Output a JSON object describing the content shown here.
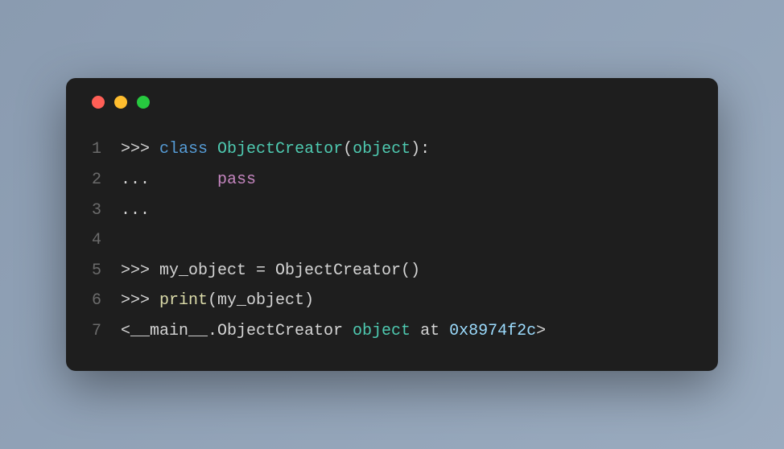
{
  "window": {
    "traffic_lights": [
      "red",
      "yellow",
      "green"
    ]
  },
  "code": {
    "lines": [
      {
        "n": "1",
        "tokens": [
          {
            "t": ">>> ",
            "c": "tk-prompt"
          },
          {
            "t": "class",
            "c": "tk-keyword"
          },
          {
            "t": " ",
            "c": "tk-default"
          },
          {
            "t": "ObjectCreator",
            "c": "tk-classname"
          },
          {
            "t": "(",
            "c": "tk-punct"
          },
          {
            "t": "object",
            "c": "tk-builtin"
          },
          {
            "t": "):",
            "c": "tk-punct"
          }
        ]
      },
      {
        "n": "2",
        "tokens": [
          {
            "t": "...       ",
            "c": "tk-prompt"
          },
          {
            "t": "pass",
            "c": "tk-pass"
          }
        ]
      },
      {
        "n": "3",
        "tokens": [
          {
            "t": "...",
            "c": "tk-prompt"
          }
        ]
      },
      {
        "n": "4",
        "tokens": []
      },
      {
        "n": "5",
        "tokens": [
          {
            "t": ">>> my_object = ObjectCreator()",
            "c": "tk-default"
          }
        ]
      },
      {
        "n": "6",
        "tokens": [
          {
            "t": ">>> ",
            "c": "tk-prompt"
          },
          {
            "t": "print",
            "c": "tk-func"
          },
          {
            "t": "(my_object)",
            "c": "tk-default"
          }
        ]
      },
      {
        "n": "7",
        "tokens": [
          {
            "t": "<__main__.ObjectCreator ",
            "c": "tk-default"
          },
          {
            "t": "object",
            "c": "tk-builtin"
          },
          {
            "t": " at ",
            "c": "tk-default"
          },
          {
            "t": "0x8974f2c",
            "c": "tk-number"
          },
          {
            "t": ">",
            "c": "tk-default"
          }
        ]
      }
    ]
  }
}
